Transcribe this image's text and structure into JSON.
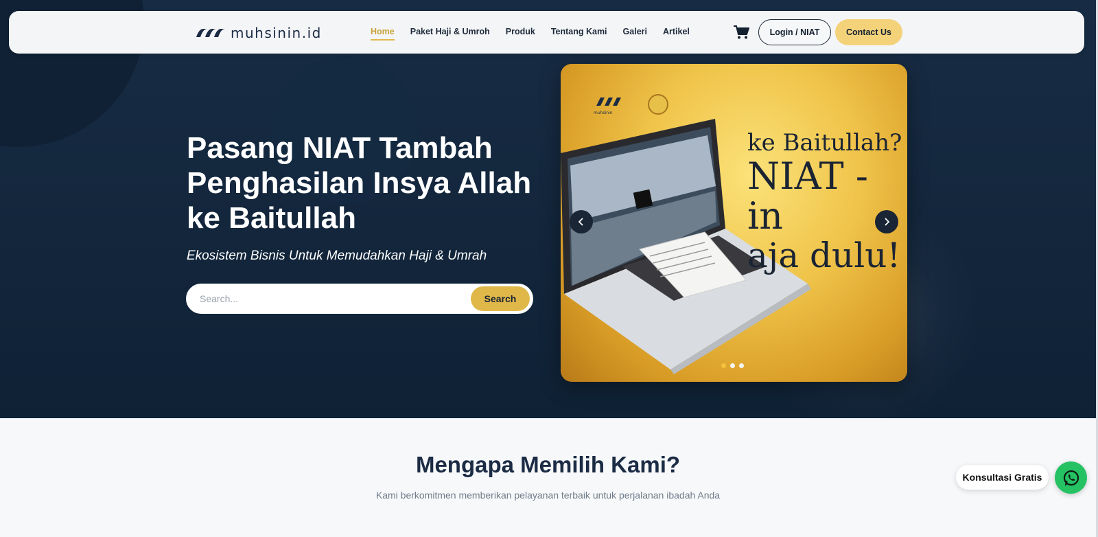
{
  "brand": {
    "name": "muhsinin.id",
    "accent": "#e0b84a",
    "navy": "#13263c"
  },
  "nav": {
    "links": [
      "Home",
      "Paket Haji & Umroh",
      "Produk",
      "Tentang Kami",
      "Galeri",
      "Artikel"
    ],
    "active": "Home",
    "cart_icon": "shopping-cart-icon",
    "login_label": "Login / NIAT",
    "contact_label": "Contact Us"
  },
  "hero": {
    "title": "Pasang NIAT Tambah Penghasilan Insya Allah ke Baitullah",
    "subtitle": "Ekosistem Bisnis Untuk Memudahkan Haji & Umrah",
    "search": {
      "placeholder": "Search...",
      "button_label": "Search"
    }
  },
  "carousel": {
    "slide_text": {
      "line1": "ke Baitullah?",
      "line2": "NIAT - in",
      "line3": "aja dulu!"
    },
    "slide_logo_text": "muhsinin",
    "slide_count": 3,
    "active_index": 0,
    "prev_icon": "chevron-left-icon",
    "next_icon": "chevron-right-icon"
  },
  "why_section": {
    "title": "Mengapa Memilih Kami?",
    "subtitle": "Kami berkomitmen memberikan pelayanan terbaik untuk perjalanan ibadah Anda"
  },
  "floating_chat": {
    "label": "Konsultasi Gratis",
    "icon": "whatsapp-icon",
    "color": "#25c264"
  }
}
